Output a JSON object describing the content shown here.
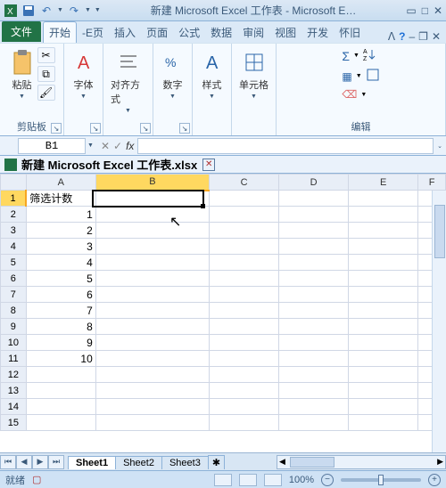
{
  "title": "新建 Microsoft Excel 工作表 - Microsoft E…",
  "ribbon": {
    "file": "文件",
    "tabs": [
      "开始",
      "-E页",
      "插入",
      "页面",
      "公式",
      "数据",
      "审阅",
      "视图",
      "开发",
      "怀旧"
    ],
    "groups": {
      "clipboard": {
        "paste": "粘贴",
        "label": "剪贴板"
      },
      "font": {
        "label": "字体"
      },
      "align": {
        "label": "对齐方式"
      },
      "number": {
        "label": "数字"
      },
      "styles": {
        "label": "样式"
      },
      "cells": {
        "label": "单元格"
      },
      "editing": {
        "label": "编辑"
      }
    }
  },
  "namebox": "B1",
  "workbook_name": "新建 Microsoft Excel 工作表.xlsx",
  "columns": [
    "A",
    "B",
    "C",
    "D",
    "E",
    "F"
  ],
  "rows": [
    {
      "n": 1,
      "A": "筛选计数",
      "B": ""
    },
    {
      "n": 2,
      "A": "1"
    },
    {
      "n": 3,
      "A": "2"
    },
    {
      "n": 4,
      "A": "3"
    },
    {
      "n": 5,
      "A": "4"
    },
    {
      "n": 6,
      "A": "5"
    },
    {
      "n": 7,
      "A": "6"
    },
    {
      "n": 8,
      "A": "7"
    },
    {
      "n": 9,
      "A": "8"
    },
    {
      "n": 10,
      "A": "9"
    },
    {
      "n": 11,
      "A": "10"
    },
    {
      "n": 12,
      "A": ""
    },
    {
      "n": 13,
      "A": ""
    },
    {
      "n": 14,
      "A": ""
    },
    {
      "n": 15,
      "A": ""
    }
  ],
  "selected": {
    "col": "B",
    "row": 1
  },
  "sheets": [
    "Sheet1",
    "Sheet2",
    "Sheet3"
  ],
  "active_sheet": 0,
  "status": {
    "ready": "就绪",
    "zoom": "100%"
  }
}
